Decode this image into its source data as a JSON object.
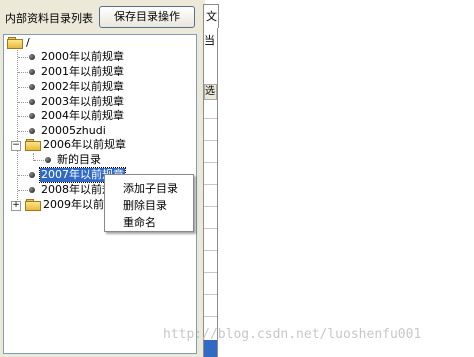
{
  "toolbar": {
    "title": "内部资料目录列表",
    "save_button": "保存目录操作"
  },
  "tree": {
    "root_label": "/",
    "items": [
      {
        "label": "2000年以前规章"
      },
      {
        "label": "2001年以前规章"
      },
      {
        "label": "2002年以前规章"
      },
      {
        "label": "2003年以前规章"
      },
      {
        "label": "2004年以前规章"
      },
      {
        "label": "20005zhudi"
      },
      {
        "label": "2006年以前规章"
      },
      {
        "label": "新的目录"
      },
      {
        "label": "2007年以前规章"
      },
      {
        "label": "2008年以前规"
      },
      {
        "label": "2009年以前规"
      }
    ]
  },
  "context_menu": {
    "items": [
      "添加子目录",
      "删除目录",
      "重命名"
    ]
  },
  "right_panel": {
    "tab_label": "文",
    "label": "当",
    "grid_header": "选"
  },
  "watermark": "http://blog.csdn.net/luoshenfu001"
}
